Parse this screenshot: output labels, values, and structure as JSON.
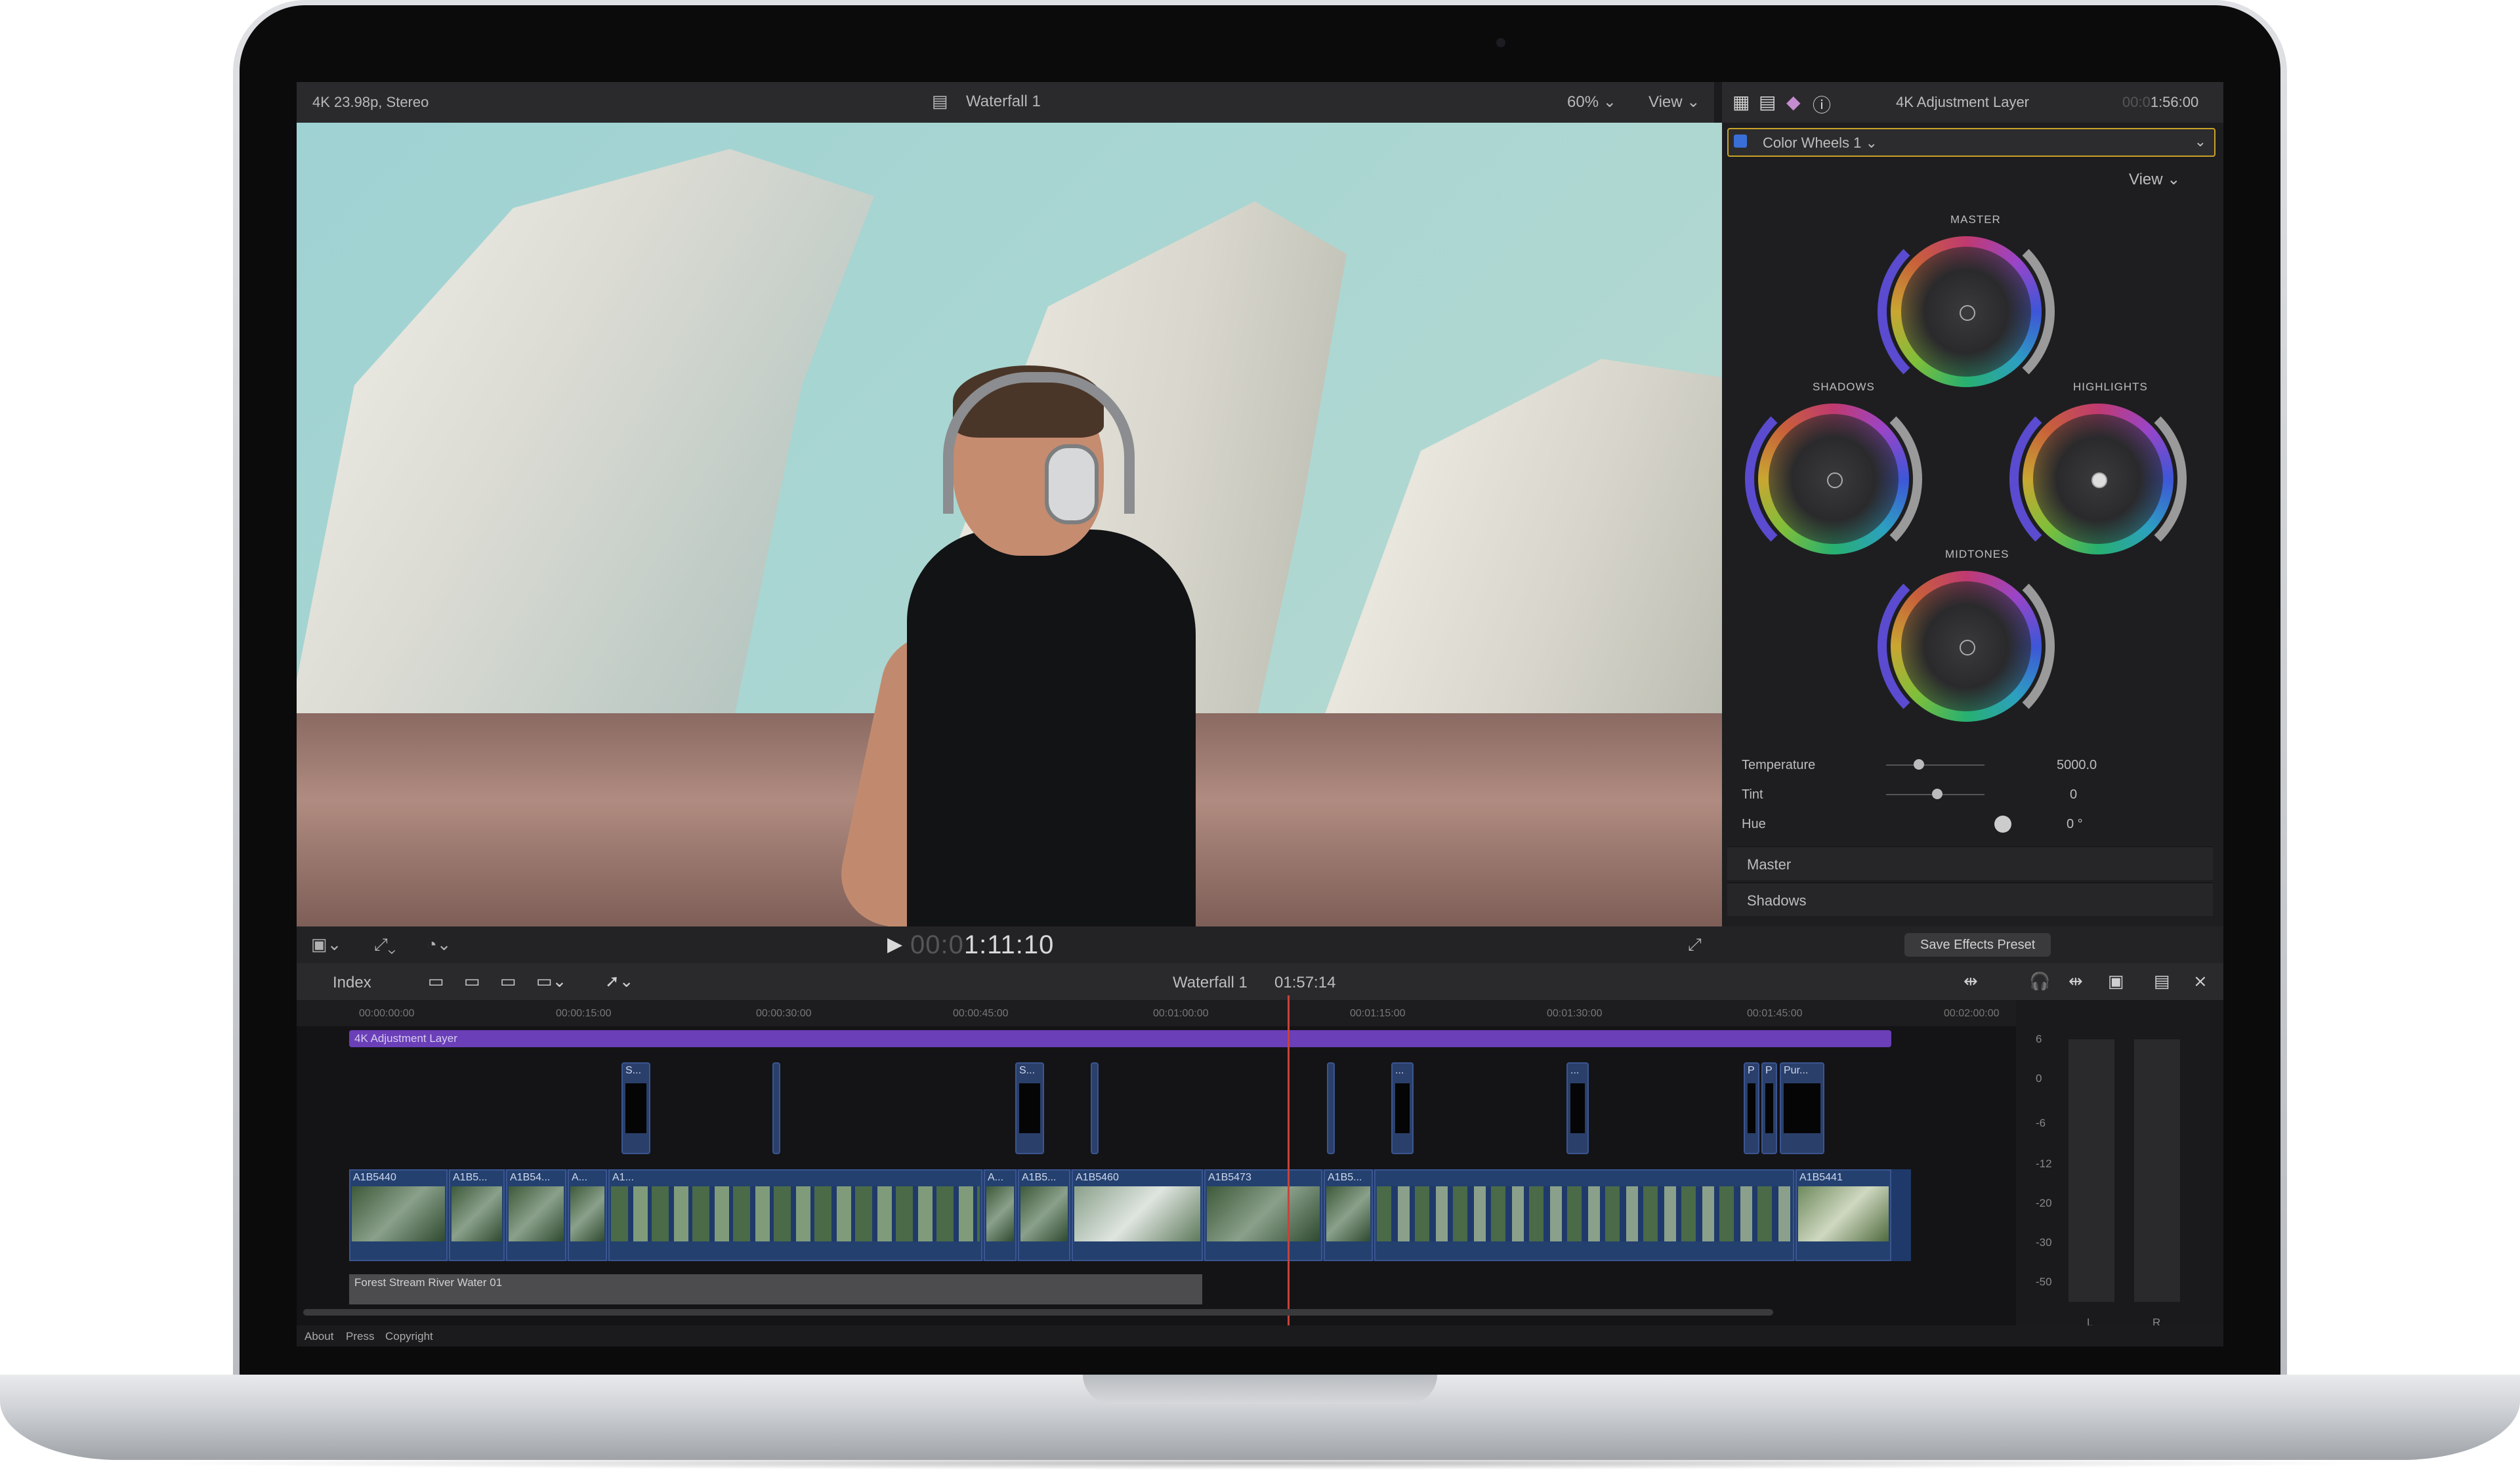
{
  "viewer": {
    "format": "4K 23.98p, Stereo",
    "project_title": "Waterfall 1",
    "zoom": "60%",
    "view_label": "View",
    "timecode_prefix": "00:0",
    "timecode": "1:11:10"
  },
  "inspector": {
    "clip_name": "4K Adjustment Layer",
    "time_prefix": "00:0",
    "time": "1:56:00",
    "effect_name": "Color Wheels 1",
    "view_label": "View",
    "wheels": {
      "master": "MASTER",
      "shadows": "SHADOWS",
      "highlights": "HIGHLIGHTS",
      "midtones": "MIDTONES"
    },
    "params": [
      {
        "label": "Temperature",
        "value": "5000.0"
      },
      {
        "label": "Tint",
        "value": "0"
      },
      {
        "label": "Hue",
        "value": "0 °"
      }
    ],
    "sections": [
      "Master",
      "Shadows"
    ],
    "save_button": "Save Effects Preset"
  },
  "timeline": {
    "index_label": "Index",
    "project_name": "Waterfall 1",
    "duration": "01:57:14",
    "ruler": [
      "00:00:00:00",
      "00:00:15:00",
      "00:00:30:00",
      "00:00:45:00",
      "00:01:00:00",
      "00:01:15:00",
      "00:01:30:00",
      "00:01:45:00",
      "00:02:00:00"
    ],
    "adjustment_layer": "4K Adjustment Layer",
    "connected_clips": [
      "S...",
      "S...",
      "...",
      "...",
      "P",
      "P",
      "Pur..."
    ],
    "primary_clips": [
      "A1B5440",
      "A1B5...",
      "A1B54...",
      "A...",
      "A1...",
      "A...",
      "A1B5...",
      "A1B5460",
      "A1B5473",
      "A1B5...",
      "A1B5441"
    ],
    "audio_clip": "Forest Stream River Water 01",
    "meter_scale": [
      "6",
      "0",
      "-6",
      "-12",
      "-20",
      "-30",
      "-50"
    ],
    "meter_channels": [
      "L",
      "R"
    ]
  },
  "footer": {
    "links": [
      "About",
      "Press",
      "Copyright"
    ]
  },
  "colors": {
    "accent_yellow": "#c9a227",
    "adjustment_purple": "#6a3fb8",
    "clip_blue": "#23406f",
    "playhead_red": "#c8423a"
  }
}
